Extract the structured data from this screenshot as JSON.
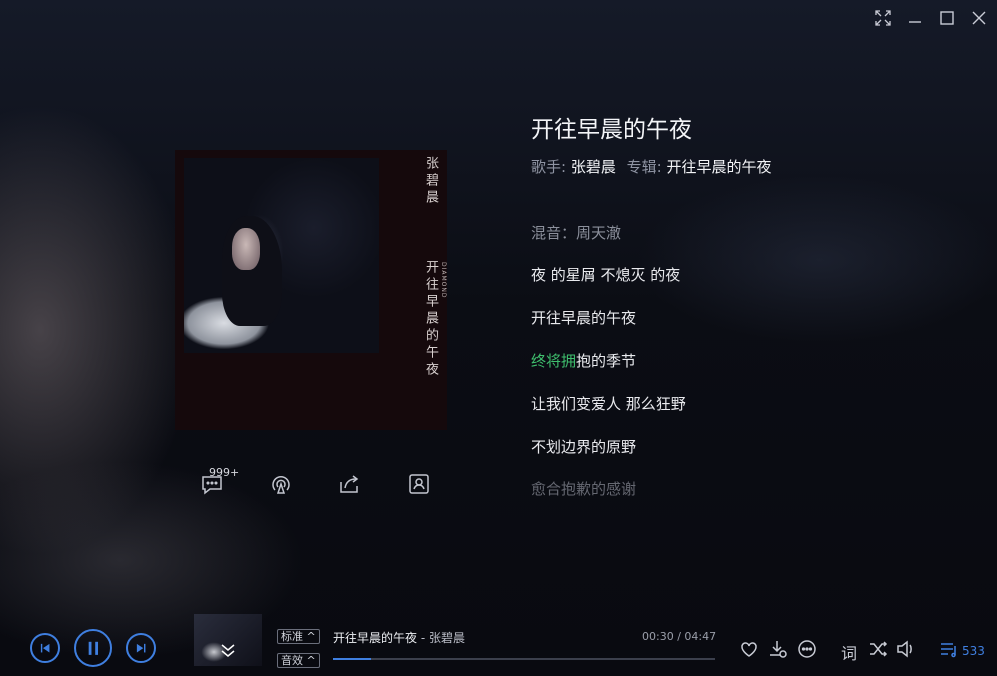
{
  "window": {
    "controls": [
      "fullscreen-icon",
      "minimize-icon",
      "maximize-icon",
      "close-icon"
    ]
  },
  "album_cover": {
    "artist_vertical": "张碧晨",
    "title_vertical": "开往早晨的午夜",
    "small_text": "DIAMOND"
  },
  "actions": {
    "comment_count": "999+",
    "icons": [
      "comment-icon",
      "radio-icon",
      "share-icon",
      "profile-card-icon"
    ]
  },
  "song": {
    "title": "开往早晨的午夜",
    "singer_label": "歌手:",
    "singer": "张碧晨",
    "album_label": "专辑:",
    "album": "开往早晨的午夜"
  },
  "lyrics": {
    "credit": "混音：周天澈",
    "line1": "夜 的星屑 不熄灭 的夜",
    "line2": "开往早晨的午夜",
    "current_sung": "终将拥",
    "current_rest": "抱的季节",
    "line4": "让我们变爱人 那么狂野",
    "line5": "不划边界的原野",
    "line6": "愈合抱歉的感谢"
  },
  "player": {
    "quality_label": "标准",
    "effect_label": "音效",
    "now_playing_title": "开往早晨的午夜",
    "now_playing_sep": " - ",
    "now_playing_artist": "张碧晨",
    "current_time": "00:30",
    "time_sep": " / ",
    "total_time": "04:47",
    "progress": 0.1,
    "lyrics_button": "词",
    "playlist_count": "533",
    "accent_color": "#3f7fe0",
    "sung_color": "#3fbf6e"
  }
}
